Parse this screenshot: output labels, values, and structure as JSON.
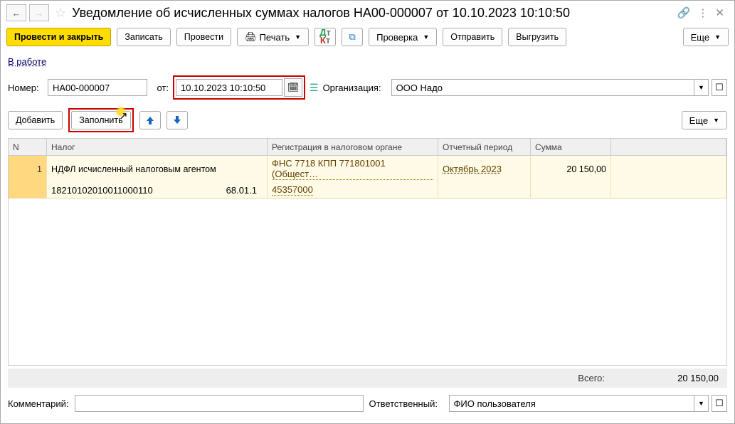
{
  "header": {
    "title": "Уведомление об исчисленных суммах налогов НА00-000007 от 10.10.2023 10:10:50"
  },
  "toolbar": {
    "post_close": "Провести и закрыть",
    "write": "Записать",
    "post": "Провести",
    "print": "Печать",
    "check": "Проверка",
    "send": "Отправить",
    "export": "Выгрузить",
    "more": "Еще"
  },
  "stage": {
    "label": "В работе"
  },
  "fields": {
    "number_lbl": "Номер:",
    "number": "НА00-000007",
    "date_lbl": "от:",
    "date": "10.10.2023 10:10:50",
    "org_lbl": "Организация:",
    "org": "ООО Надо"
  },
  "sub_toolbar": {
    "add": "Добавить",
    "fill": "Заполнить",
    "more": "Еще"
  },
  "grid": {
    "cols": {
      "n": "N",
      "tax": "Налог",
      "reg": "Регистрация в налоговом органе",
      "per": "Отчетный период",
      "sum": "Сумма"
    },
    "rows": [
      {
        "n": "1",
        "tax": "НДФЛ исчисленный налоговым агентом",
        "kbk": "18210102010011000110",
        "acc": "68.01.1",
        "reg": "ФНС 7718 КПП 771801001 (Общест…",
        "oktmo": "45357000",
        "period": "Октябрь 2023",
        "sum": "20 150,00"
      }
    ]
  },
  "total": {
    "label": "Всего:",
    "value": "20 150,00"
  },
  "bottom": {
    "comment_lbl": "Комментарий:",
    "comment": "",
    "resp_lbl": "Ответственный:",
    "resp": "ФИО пользователя"
  }
}
